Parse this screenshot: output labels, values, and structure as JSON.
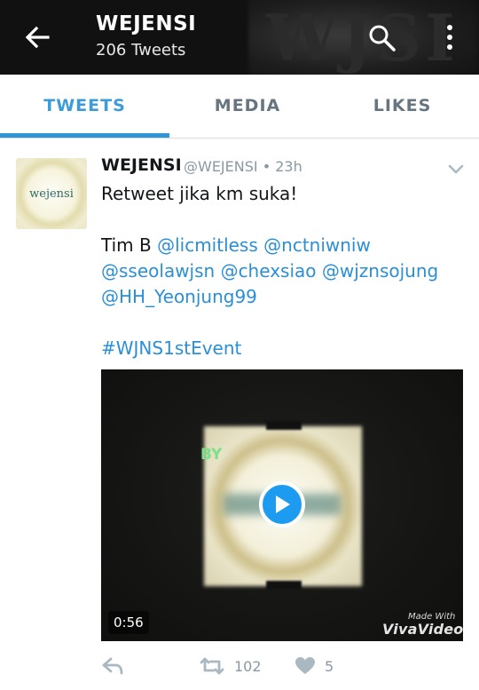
{
  "header": {
    "title": "WEJENSI",
    "subtitle": "206 Tweets",
    "back_icon": "arrow-left-icon",
    "search_icon": "search-icon",
    "more_icon": "more-vertical-icon",
    "background_text": "WJSI"
  },
  "tabs": [
    {
      "label": "TWEETS",
      "active": true
    },
    {
      "label": "MEDIA",
      "active": false
    },
    {
      "label": "LIKES",
      "active": false
    }
  ],
  "tweet": {
    "avatar_text": "wejensi",
    "name": "WEJENSI",
    "handle_time": "@WEJENSI • 23h",
    "line1": "Retweet jika km suka!",
    "line2_prefix": "Tim B ",
    "mentions": [
      "@licmitless",
      "@nctniwniw",
      "@sseolawjsn",
      "@chexsiao",
      "@wjznsojung",
      "@HH_Yeonjung99"
    ],
    "hashtag": "#WJNS1stEvent",
    "video": {
      "overlay_text": "BY",
      "duration": "0:56",
      "watermark_small": "Made With",
      "watermark_big": "VivaVideo"
    },
    "actions": {
      "reply_icon": "reply-icon",
      "retweet_icon": "retweet-icon",
      "retweet_count": "102",
      "like_icon": "heart-icon",
      "like_count": "5"
    }
  },
  "colors": {
    "header_bg": "#111111",
    "accent": "#2e95d6",
    "link": "#2b8fd6",
    "muted": "#8899a6"
  }
}
